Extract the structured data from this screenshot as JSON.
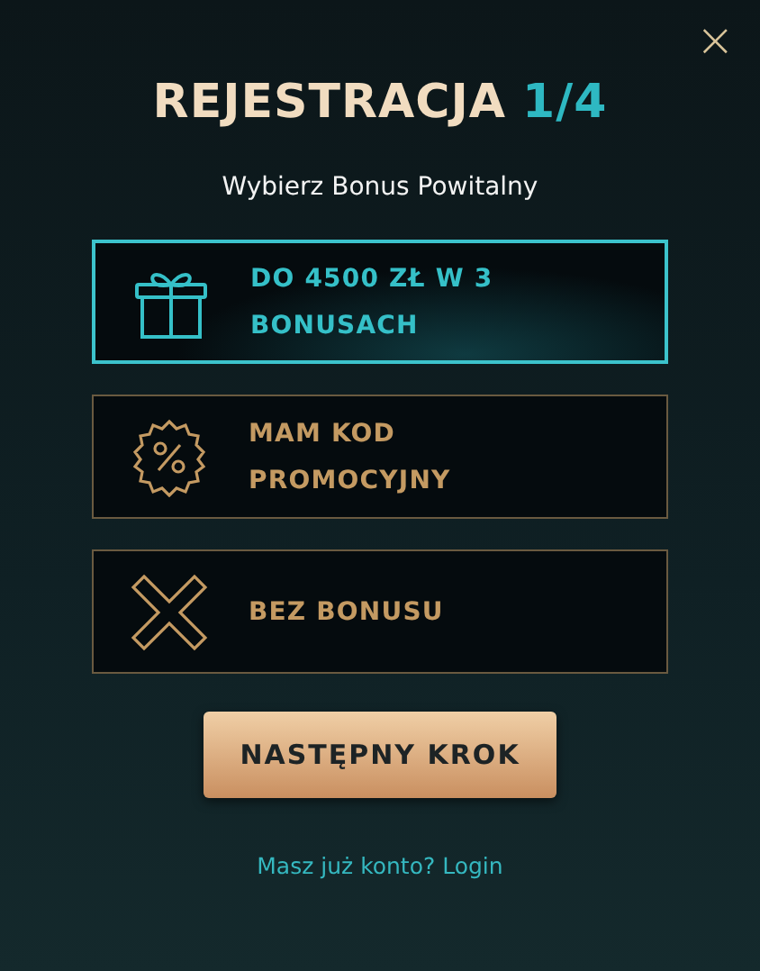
{
  "close": "×",
  "title": {
    "text": "REJESTRACJA",
    "step": "1/4"
  },
  "subtitle": "Wybierz Bonus Powitalny",
  "options": [
    {
      "kind": "gift",
      "label": "DO 4500 ZŁ W 3 BONUSACH",
      "selected": true
    },
    {
      "kind": "percent",
      "label": "MAM KOD PROMOCYJNY",
      "selected": false
    },
    {
      "kind": "none",
      "label": "BEZ BONUSU",
      "selected": false
    }
  ],
  "next_button": "NASTĘPNY KROK",
  "footer": {
    "prompt": "Masz już konto?",
    "link": "Login"
  }
}
